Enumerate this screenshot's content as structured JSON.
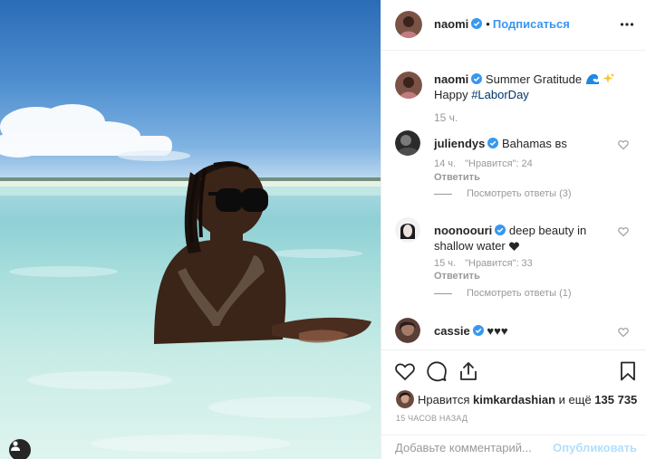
{
  "header": {
    "username": "naomi",
    "separator": "•",
    "follow_label": "Подписаться",
    "more_icon": "more-options-icon"
  },
  "caption": {
    "username": "naomi",
    "text_before": "Summer Gratitude",
    "emojis": [
      "wave-emoji",
      "sparkles-emoji"
    ],
    "line2_prefix": "Happy ",
    "hashtag": "#LaborDay",
    "time": "15 ч."
  },
  "comments": [
    {
      "username": "juliendys",
      "verified": true,
      "text": "Bahamas вs",
      "time": "14 ч.",
      "likes": "\"Нравится\": 24",
      "reply": "Ответить",
      "view_replies": "Посмотреть ответы (3)"
    },
    {
      "username": "noonoouri",
      "verified": true,
      "text": "deep beauty in shallow water",
      "emoji": "black-heart-emoji",
      "time": "15 ч.",
      "likes": "\"Нравится\": 33",
      "reply": "Ответить",
      "view_replies": "Посмотреть ответы (1)"
    },
    {
      "username": "cassie",
      "verified": true,
      "text": "♥♥♥"
    }
  ],
  "actions": {
    "like_icon": "heart-icon",
    "comment_icon": "comment-icon",
    "share_icon": "share-icon",
    "save_icon": "bookmark-icon"
  },
  "likes": {
    "prefix": "Нравится ",
    "user": "kimkardashian",
    "middle": " и ещё ",
    "count": "135 735"
  },
  "post_time": "15 ЧАСОВ НАЗАД",
  "add_comment": {
    "placeholder": "Добавьте комментарий...",
    "publish_label": "Опубликовать"
  },
  "colors": {
    "accent": "#3897f0",
    "text": "#262626",
    "muted": "#999999",
    "border": "#efefef",
    "publish_disabled": "#b2dffc"
  }
}
